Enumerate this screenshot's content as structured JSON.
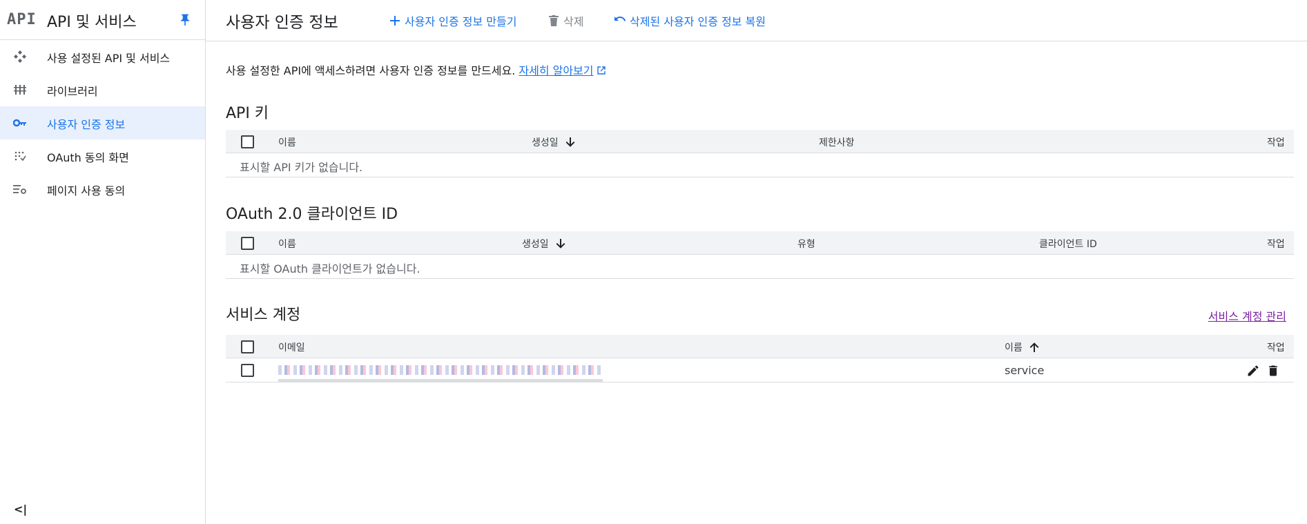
{
  "sidebar": {
    "logo": "API",
    "title": "API 및 서비스",
    "items": [
      {
        "label": "사용 설정된 API 및 서비스",
        "icon": "apis-diamond-icon",
        "active": false
      },
      {
        "label": "라이브러리",
        "icon": "library-icon",
        "active": false
      },
      {
        "label": "사용자 인증 정보",
        "icon": "key-icon",
        "active": true
      },
      {
        "label": "OAuth 동의 화면",
        "icon": "dots-grid-icon",
        "active": false
      },
      {
        "label": "페이지 사용 동의",
        "icon": "settings-list-icon",
        "active": false
      }
    ],
    "collapse": "<|"
  },
  "topbar": {
    "title": "사용자 인증 정보",
    "create_label": "사용자 인증 정보 만들기",
    "delete_label": "삭제",
    "restore_label": "삭제된 사용자 인증 정보 복원"
  },
  "intro": {
    "text": "사용 설정한 API에 액세스하려면 사용자 인증 정보를 만드세요.",
    "link": "자세히 알아보기"
  },
  "api_keys": {
    "title": "API 키",
    "columns": {
      "name": "이름",
      "created": "생성일",
      "restrictions": "제한사항",
      "actions": "작업"
    },
    "empty": "표시할 API 키가 없습니다."
  },
  "oauth": {
    "title": "OAuth 2.0 클라이언트 ID",
    "columns": {
      "name": "이름",
      "created": "생성일",
      "type": "유형",
      "client_id": "클라이언트 ID",
      "actions": "작업"
    },
    "empty": "표시할 OAuth 클라이언트가 없습니다."
  },
  "service_accounts": {
    "title": "서비스 계정",
    "manage_link": "서비스 계정 관리",
    "columns": {
      "email": "이메일",
      "name": "이름",
      "actions": "작업"
    },
    "rows": [
      {
        "name": "service"
      }
    ]
  },
  "colors": {
    "accent": "#1a73e8",
    "link_visited": "#7b1fa2",
    "header_bg": "#f1f3f4"
  }
}
